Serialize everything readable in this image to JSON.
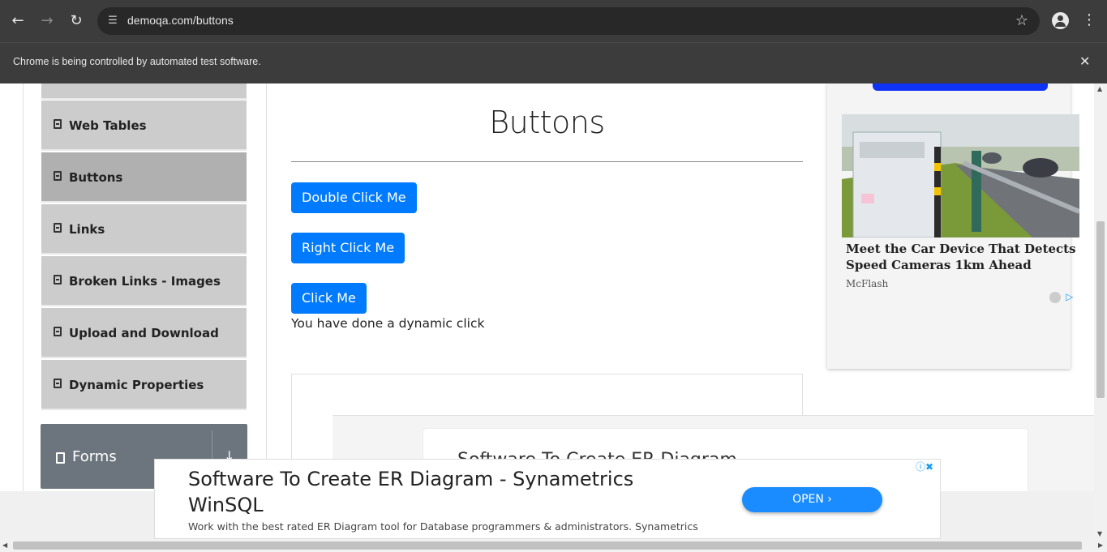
{
  "browser": {
    "url": "demoqa.com/buttons",
    "infobar_message": "Chrome is being controlled by automated test software."
  },
  "sidebar": {
    "items": [
      {
        "label": "Web Tables",
        "active": false
      },
      {
        "label": "Buttons",
        "active": true
      },
      {
        "label": "Links",
        "active": false
      },
      {
        "label": "Broken Links - Images",
        "active": false
      },
      {
        "label": "Upload and Download",
        "active": false
      },
      {
        "label": "Dynamic Properties",
        "active": false
      }
    ],
    "group": {
      "label": "Forms"
    }
  },
  "main": {
    "title": "Buttons",
    "buttons": {
      "double_click": "Double Click Me",
      "right_click": "Right Click Me",
      "click": "Click Me"
    },
    "dynamic_message": "You have done a dynamic click"
  },
  "right_ad": {
    "title": "Meet the Car Device That Detects Speed Cameras 1km Ahead",
    "source": "McFlash"
  },
  "content_ad": {
    "ghost_title": "Software To Create ER Diagram"
  },
  "bottom_ad": {
    "headline": "Software To Create ER Diagram - Synametrics WinSQL",
    "description": "Work with the best rated ER Diagram tool for Database programmers & administrators. Synametrics",
    "cta": "OPEN"
  },
  "colors": {
    "primary_button": "#007bff",
    "chrome_bar": "#3c3c3c",
    "sidebar_item": "#cccccc",
    "sidebar_active": "#b0b0b0"
  }
}
